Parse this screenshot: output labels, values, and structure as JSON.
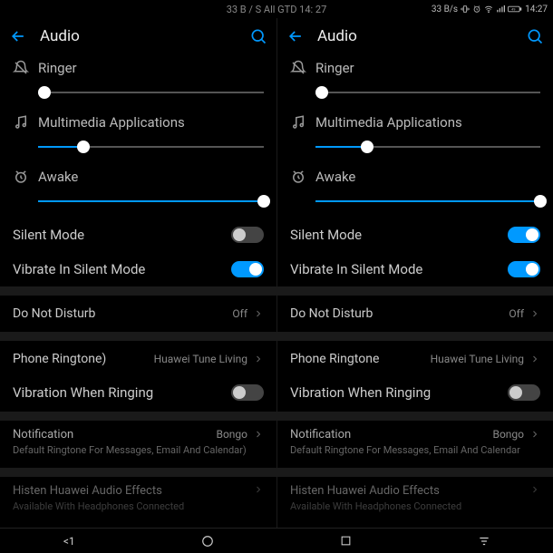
{
  "status": {
    "center": "33 B / S All GTD 14: 27",
    "right": "33 B/s",
    "time": "14:27"
  },
  "panels": [
    {
      "title": "Audio",
      "ringer": {
        "label": "Ringer",
        "value": 3
      },
      "multimedia": {
        "label": "Multimedia Applications",
        "value": 20
      },
      "awake": {
        "label": "Awake",
        "value": 100
      },
      "silentMode": {
        "label": "Silent Mode",
        "on": false
      },
      "vibrateSilent": {
        "label": "Vibrate In Silent Mode",
        "on": true
      },
      "dnd": {
        "label": "Do Not Disturb",
        "value": "Off"
      },
      "ringtone": {
        "label": "Phone Ringtone)",
        "value": "Huawei Tune Living"
      },
      "vibrateRinging": {
        "label": "Vibration When Ringing",
        "on": false
      },
      "notification": {
        "title": "Notification",
        "desc": "Default Ringtone For Messages, Email And Calendar)",
        "value": "Bongo"
      },
      "audioEffects": {
        "title": "Histen Huawei Audio Effects",
        "desc": "Available With Headphones Connected"
      }
    },
    {
      "title": "Audio",
      "ringer": {
        "label": "Ringer",
        "value": 3
      },
      "multimedia": {
        "label": "Multimedia Applications",
        "value": 23
      },
      "awake": {
        "label": "Awake",
        "value": 100
      },
      "silentMode": {
        "label": "Silent Mode",
        "on": true
      },
      "vibrateSilent": {
        "label": "Vibrate In Silent Mode",
        "on": true
      },
      "dnd": {
        "label": "Do Not Disturb",
        "value": "Off"
      },
      "ringtone": {
        "label": "Phone Ringtone",
        "value": "Huawei Tune Living"
      },
      "vibrateRinging": {
        "label": "Vibration When Ringing",
        "on": false
      },
      "notification": {
        "title": "Notification",
        "desc": "Default Ringtone For Messages, Email And Calendar",
        "value": "Bongo"
      },
      "audioEffects": {
        "title": "Histen Huawei Audio Effects",
        "desc": "Available With Headphones Connected"
      }
    }
  ],
  "navbar": {
    "back": "<1"
  }
}
